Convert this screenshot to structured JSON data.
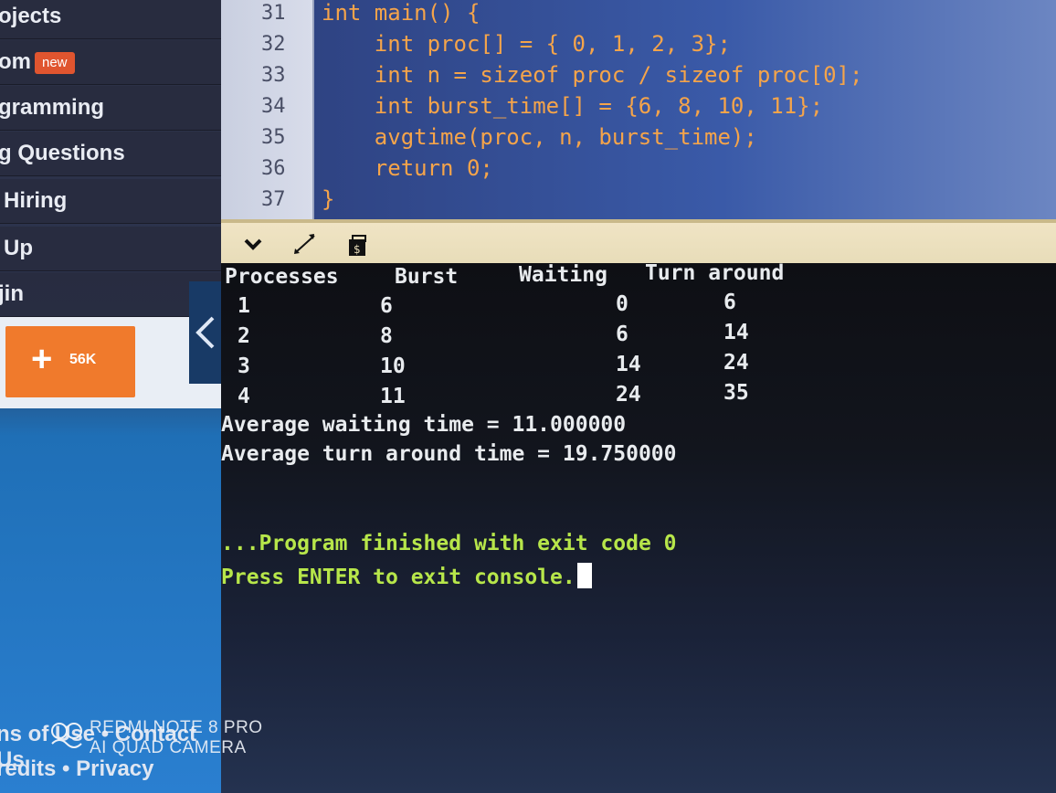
{
  "sidebar": {
    "items": [
      {
        "label": "ojects"
      },
      {
        "label": "om",
        "badge": "new"
      },
      {
        "label": "gramming"
      },
      {
        "label": "g Questions"
      },
      {
        "label": "Hiring"
      },
      {
        "label": "Up"
      },
      {
        "label": "jin"
      }
    ],
    "share_count": "56K",
    "footer_line1": "ns of Use • Contact Us",
    "footer_line2": "redits • Privacy"
  },
  "editor": {
    "lines": [
      {
        "num": "31",
        "code": "int main() {"
      },
      {
        "num": "32",
        "code": "    int proc[] = { 0, 1, 2, 3};"
      },
      {
        "num": "33",
        "code": "    int n = sizeof proc / sizeof proc[0];"
      },
      {
        "num": "34",
        "code": "    int burst_time[] = {6, 8, 10, 11};"
      },
      {
        "num": "35",
        "code": "    avgtime(proc, n, burst_time);"
      },
      {
        "num": "36",
        "code": "    return 0;"
      },
      {
        "num": "37",
        "code": "}"
      }
    ]
  },
  "console": {
    "header": {
      "processes": "Processes",
      "burst": "Burst",
      "waiting": "Waiting",
      "turnaround": "Turn around"
    },
    "rows": [
      {
        "p": "1",
        "b": "6",
        "w": "0",
        "t": "6"
      },
      {
        "p": "2",
        "b": "8",
        "w": "6",
        "t": "14"
      },
      {
        "p": "3",
        "b": "10",
        "w": "14",
        "t": "24"
      },
      {
        "p": "4",
        "b": "11",
        "w": "24",
        "t": "35"
      }
    ],
    "avg_waiting": "Average waiting time = 11.000000",
    "avg_turnaround": "Average turn around time = 19.750000",
    "finished": "...Program finished with exit code 0",
    "press_enter": "Press ENTER to exit console."
  },
  "watermark": {
    "line1": "REDMI NOTE 8 PRO",
    "line2": "AI QUAD CAMERA"
  },
  "colors": {
    "console_green": "#b7e64a",
    "code_orange": "#f5a44a",
    "share_orange": "#f07a2c",
    "badge_red": "#e0552f"
  },
  "icons": [
    "chevron-down-icon",
    "expand-icon",
    "stdin-icon",
    "chevron-left-icon",
    "plus-icon"
  ]
}
